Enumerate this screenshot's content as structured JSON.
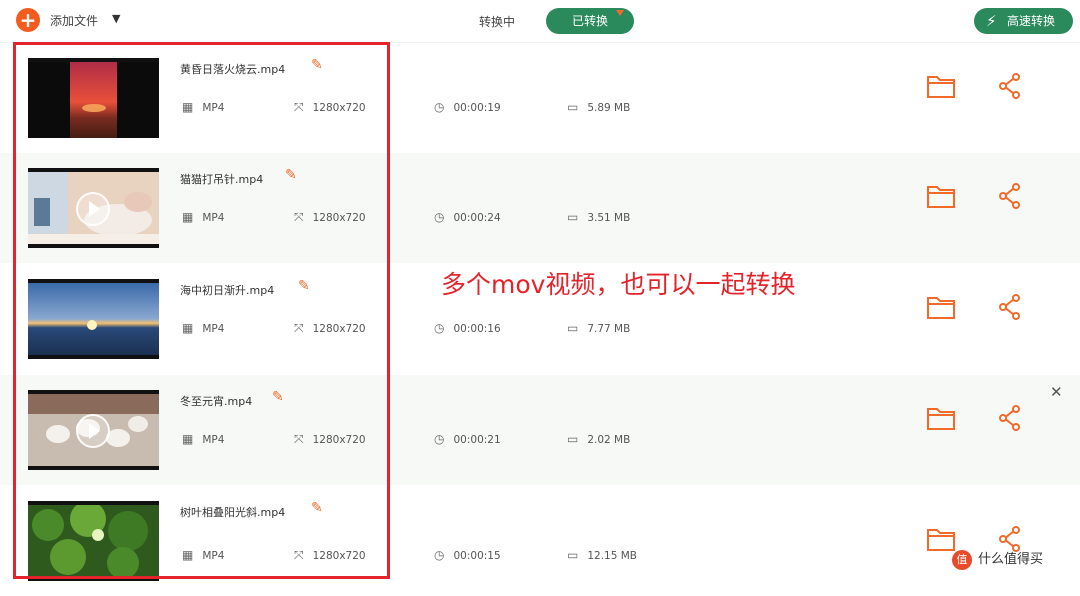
{
  "toolbar": {
    "add_file_label": "添加文件",
    "tab_converting": "转换中",
    "tab_converted": "已转换",
    "speed_convert_label": "高速转换",
    "accent_color": "#2a8a5c",
    "orange_color": "#f26a2a"
  },
  "files": [
    {
      "name": "黄昏日落火烧云.mp4",
      "format": "MP4",
      "resolution": "1280x720",
      "duration": "00:00:19",
      "size": "5.89 MB"
    },
    {
      "name": "猫猫打吊针.mp4",
      "format": "MP4",
      "resolution": "1280x720",
      "duration": "00:00:24",
      "size": "3.51 MB"
    },
    {
      "name": "海中初日渐升.mp4",
      "format": "MP4",
      "resolution": "1280x720",
      "duration": "00:00:16",
      "size": "7.77 MB"
    },
    {
      "name": "冬至元宵.mp4",
      "format": "MP4",
      "resolution": "1280x720",
      "duration": "00:00:21",
      "size": "2.02 MB"
    },
    {
      "name": "树叶相叠阳光斜.mp4",
      "format": "MP4",
      "resolution": "1280x720",
      "duration": "00:00:15",
      "size": "12.15 MB"
    }
  ],
  "annotation": {
    "text": "多个mov视频，也可以一起转换",
    "color": "#e3242b"
  },
  "watermark": {
    "logo": "值",
    "text": "什么值得买"
  }
}
